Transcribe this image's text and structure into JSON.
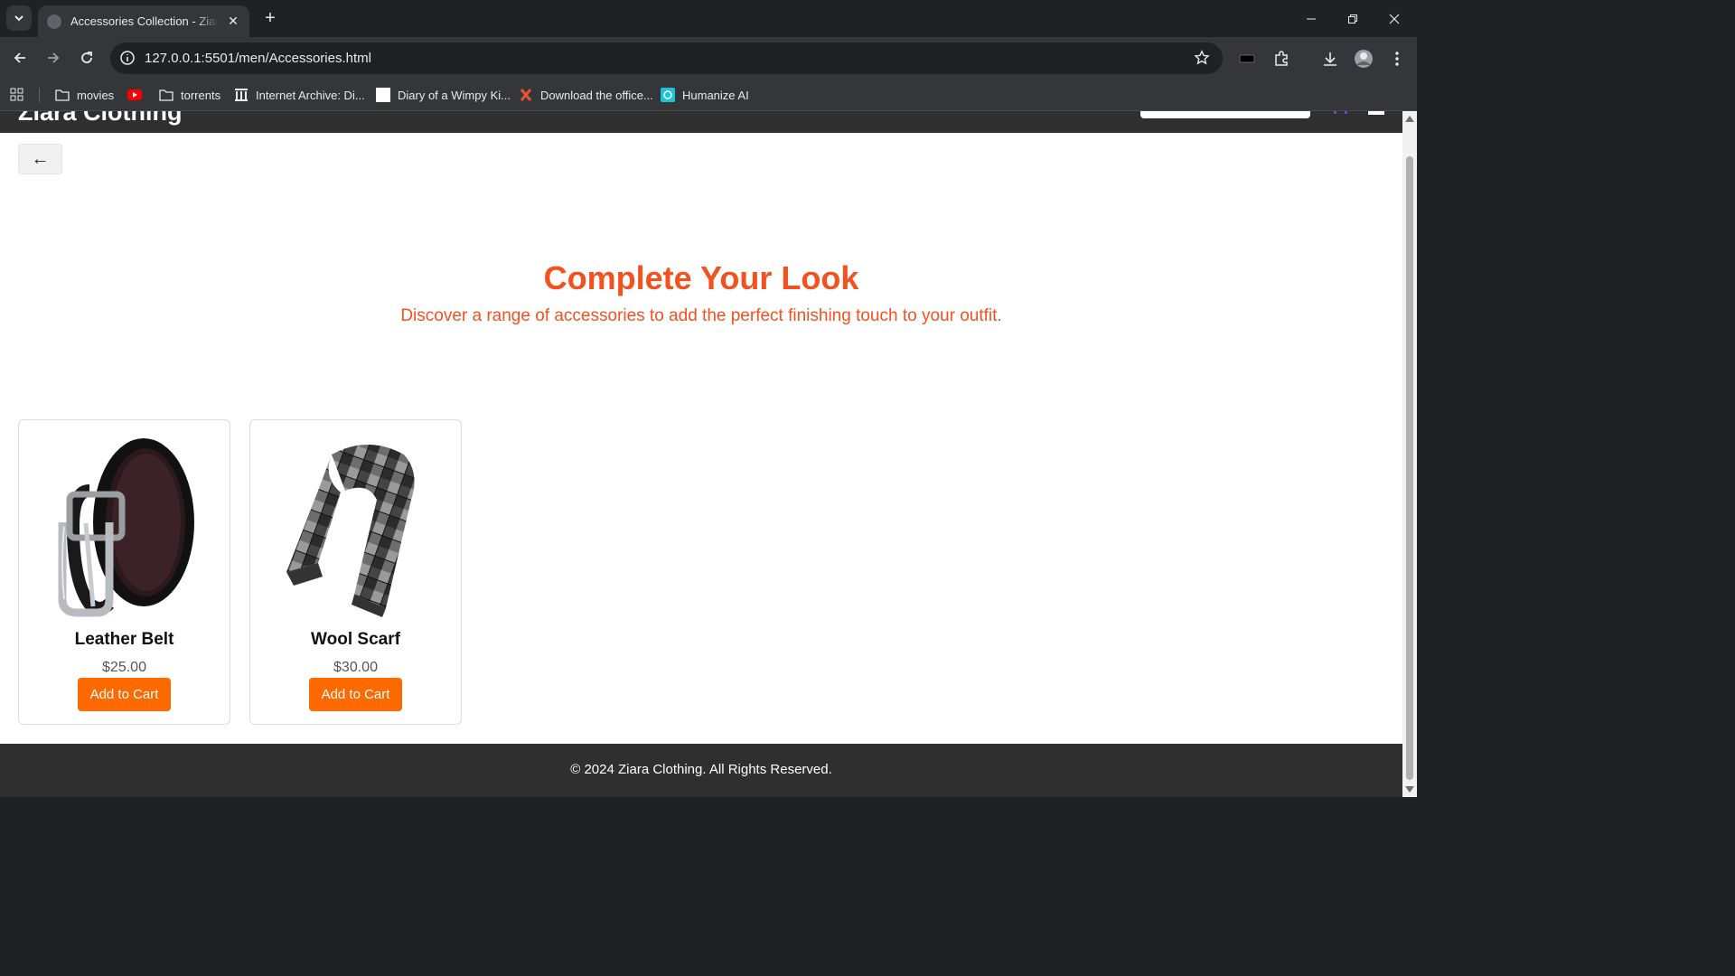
{
  "browser": {
    "tab_title": "Accessories Collection - Ziara Clothing",
    "tab_favicon": "globe-icon",
    "url": "127.0.0.1:5501/men/Accessories.html",
    "bookmarks": [
      {
        "label": "movies",
        "icon": "folder-icon"
      },
      {
        "label": "",
        "icon": "youtube-icon"
      },
      {
        "label": "torrents",
        "icon": "folder-icon"
      },
      {
        "label": "Internet Archive: Di...",
        "icon": "archive-icon"
      },
      {
        "label": "Diary of a Wimpy Ki...",
        "icon": "blank-page-icon"
      },
      {
        "label": "Download the office...",
        "icon": "x-logo-icon"
      },
      {
        "label": "Humanize AI",
        "icon": "humanize-icon"
      }
    ]
  },
  "site": {
    "brand": "Ziara Clothing",
    "back_label": "←",
    "hero_title": "Complete Your Look",
    "hero_subtitle": "Discover a range of accessories to add the perfect finishing touch to your outfit.",
    "accent_color": "#f4511e",
    "button_color": "#ff6a00",
    "products": [
      {
        "name": "Leather Belt",
        "price": "$25.00",
        "button": "Add to Cart",
        "image": "leather-belt-image"
      },
      {
        "name": "Wool Scarf",
        "price": "$30.00",
        "button": "Add to Cart",
        "image": "wool-scarf-image"
      }
    ],
    "footer": "© 2024 Ziara Clothing. All Rights Reserved."
  }
}
